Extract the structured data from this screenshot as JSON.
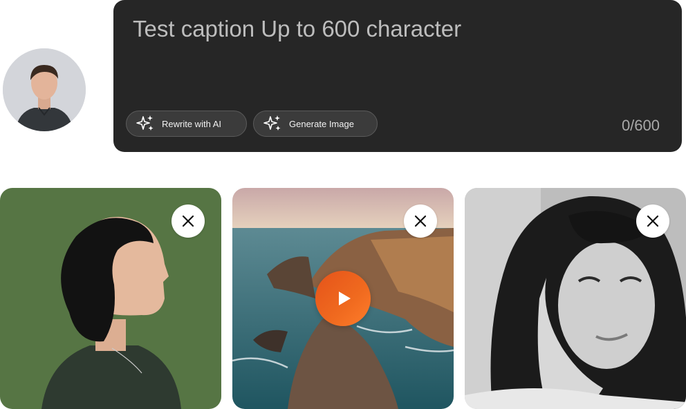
{
  "composer": {
    "placeholder": "Test caption Up to 600 character",
    "value": "",
    "counter": "0/600",
    "rewrite_label": "Rewrite with AI",
    "generate_label": "Generate Image"
  },
  "media": [
    {
      "kind": "image",
      "subject": "woman in profile on green background"
    },
    {
      "kind": "video",
      "subject": "coastal cliffs at sunset"
    },
    {
      "kind": "image",
      "subject": "black and white portrait of girl with curly hair"
    }
  ],
  "colors": {
    "composer_bg": "#262626",
    "button_bg": "#3b3b3b",
    "play_accent": "#f06a1f",
    "text_muted": "#bdbdbd"
  },
  "icons": {
    "ai": "sparkles-icon",
    "remove": "close-icon",
    "play": "play-icon"
  }
}
